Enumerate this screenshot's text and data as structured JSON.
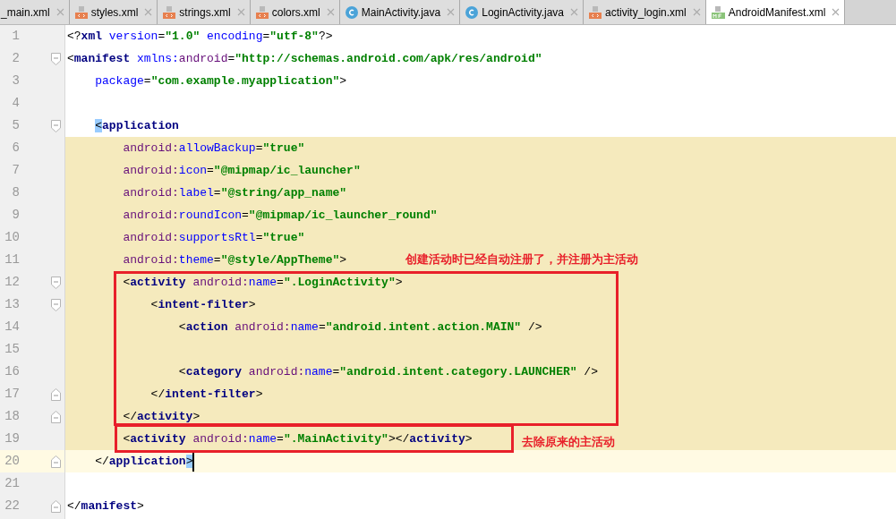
{
  "tabs": [
    {
      "label": "_main.xml",
      "kind": "cut",
      "selected": false
    },
    {
      "label": "styles.xml",
      "kind": "xml",
      "selected": false
    },
    {
      "label": "strings.xml",
      "kind": "xml",
      "selected": false
    },
    {
      "label": "colors.xml",
      "kind": "xml",
      "selected": false
    },
    {
      "label": "MainActivity.java",
      "kind": "java",
      "selected": false
    },
    {
      "label": "LoginActivity.java",
      "kind": "java",
      "selected": false
    },
    {
      "label": "activity_login.xml",
      "kind": "xml",
      "selected": false
    },
    {
      "label": "AndroidManifest.xml",
      "kind": "manifest",
      "selected": true
    }
  ],
  "editor": {
    "lines": [
      {
        "number": "1",
        "fold_open": false,
        "fold_close": false,
        "scope": false,
        "current": false,
        "tokens": [
          {
            "t": "<?",
            "kind": "punct"
          },
          {
            "t": "xml",
            "kind": "tag"
          },
          {
            "t": " version",
            "kind": "attribute"
          },
          {
            "t": "=",
            "kind": "punct"
          },
          {
            "t": "\"1.0\"",
            "kind": "value"
          },
          {
            "t": " encoding",
            "kind": "attribute"
          },
          {
            "t": "=",
            "kind": "punct"
          },
          {
            "t": "\"utf-8\"",
            "kind": "value"
          },
          {
            "t": "?>",
            "kind": "punct"
          }
        ]
      },
      {
        "number": "2",
        "fold_open": true,
        "fold_close": false,
        "scope": false,
        "current": false,
        "tokens": [
          {
            "t": "<",
            "kind": "punct"
          },
          {
            "t": "manifest",
            "kind": "tag"
          },
          {
            "t": " xmlns:",
            "kind": "attribute"
          },
          {
            "t": "android",
            "kind": "namespace"
          },
          {
            "t": "=",
            "kind": "punct"
          },
          {
            "t": "\"http://schemas.android.com/apk/res/android\"",
            "kind": "value"
          }
        ]
      },
      {
        "number": "3",
        "fold_open": false,
        "fold_close": false,
        "scope": false,
        "current": false,
        "tokens": [
          {
            "t": "    package",
            "kind": "attribute"
          },
          {
            "t": "=",
            "kind": "punct"
          },
          {
            "t": "\"com.example.myapplication\"",
            "kind": "value"
          },
          {
            "t": ">",
            "kind": "punct"
          }
        ]
      },
      {
        "number": "4",
        "fold_open": false,
        "fold_close": false,
        "scope": false,
        "current": false
      },
      {
        "number": "5",
        "fold_open": true,
        "fold_close": false,
        "scope": false,
        "current": false,
        "tokens": [
          {
            "t": "    <",
            "kind": "bracket-match"
          },
          {
            "t": "application",
            "kind": "tag"
          }
        ]
      },
      {
        "number": "6",
        "fold_open": false,
        "fold_close": false,
        "scope": true,
        "current": false,
        "tokens": [
          {
            "t": "        android:",
            "kind": "namespace"
          },
          {
            "t": "allowBackup",
            "kind": "attribute"
          },
          {
            "t": "=",
            "kind": "punct"
          },
          {
            "t": "\"true\"",
            "kind": "value"
          }
        ]
      },
      {
        "number": "7",
        "fold_open": false,
        "fold_close": false,
        "scope": true,
        "current": false,
        "tokens": [
          {
            "t": "        android:",
            "kind": "namespace"
          },
          {
            "t": "icon",
            "kind": "attribute"
          },
          {
            "t": "=",
            "kind": "punct"
          },
          {
            "t": "\"@mipmap/ic_launcher\"",
            "kind": "value"
          }
        ]
      },
      {
        "number": "8",
        "fold_open": false,
        "fold_close": false,
        "scope": true,
        "current": false,
        "tokens": [
          {
            "t": "        android:",
            "kind": "namespace"
          },
          {
            "t": "label",
            "kind": "attribute"
          },
          {
            "t": "=",
            "kind": "punct"
          },
          {
            "t": "\"@string/app_name\"",
            "kind": "value"
          }
        ]
      },
      {
        "number": "9",
        "fold_open": false,
        "fold_close": false,
        "scope": true,
        "current": false,
        "tokens": [
          {
            "t": "        android:",
            "kind": "namespace"
          },
          {
            "t": "roundIcon",
            "kind": "attribute"
          },
          {
            "t": "=",
            "kind": "punct"
          },
          {
            "t": "\"@mipmap/ic_launcher_round\"",
            "kind": "value"
          }
        ]
      },
      {
        "number": "10",
        "fold_open": false,
        "fold_close": false,
        "scope": true,
        "current": false,
        "tokens": [
          {
            "t": "        android:",
            "kind": "namespace"
          },
          {
            "t": "supportsRtl",
            "kind": "attribute"
          },
          {
            "t": "=",
            "kind": "punct"
          },
          {
            "t": "\"true\"",
            "kind": "value"
          }
        ]
      },
      {
        "number": "11",
        "fold_open": false,
        "fold_close": false,
        "scope": true,
        "current": false,
        "tokens": [
          {
            "t": "        android:",
            "kind": "namespace"
          },
          {
            "t": "theme",
            "kind": "attribute"
          },
          {
            "t": "=",
            "kind": "punct"
          },
          {
            "t": "\"@style/AppTheme\"",
            "kind": "value"
          },
          {
            "t": ">",
            "kind": "punct"
          }
        ]
      },
      {
        "number": "12",
        "fold_open": true,
        "fold_close": false,
        "scope": true,
        "current": false,
        "tokens": [
          {
            "t": "        <",
            "kind": "punct"
          },
          {
            "t": "activity",
            "kind": "tag"
          },
          {
            "t": " android:",
            "kind": "namespace"
          },
          {
            "t": "name",
            "kind": "attribute"
          },
          {
            "t": "=",
            "kind": "punct"
          },
          {
            "t": "\".LoginActivity\"",
            "kind": "value"
          },
          {
            "t": ">",
            "kind": "punct"
          }
        ]
      },
      {
        "number": "13",
        "fold_open": true,
        "fold_close": false,
        "scope": true,
        "current": false,
        "tokens": [
          {
            "t": "            <",
            "kind": "punct"
          },
          {
            "t": "intent-filter",
            "kind": "tag"
          },
          {
            "t": ">",
            "kind": "punct"
          }
        ]
      },
      {
        "number": "14",
        "fold_open": false,
        "fold_close": false,
        "scope": true,
        "current": false,
        "tokens": [
          {
            "t": "                <",
            "kind": "punct"
          },
          {
            "t": "action",
            "kind": "tag"
          },
          {
            "t": " android:",
            "kind": "namespace"
          },
          {
            "t": "name",
            "kind": "attribute"
          },
          {
            "t": "=",
            "kind": "punct"
          },
          {
            "t": "\"android.intent.action.MAIN\"",
            "kind": "value"
          },
          {
            "t": " />",
            "kind": "punct"
          }
        ]
      },
      {
        "number": "15",
        "fold_open": false,
        "fold_close": false,
        "scope": true,
        "current": false
      },
      {
        "number": "16",
        "fold_open": false,
        "fold_close": false,
        "scope": true,
        "current": false,
        "tokens": [
          {
            "t": "                <",
            "kind": "punct"
          },
          {
            "t": "category",
            "kind": "tag"
          },
          {
            "t": " android:",
            "kind": "namespace"
          },
          {
            "t": "name",
            "kind": "attribute"
          },
          {
            "t": "=",
            "kind": "punct"
          },
          {
            "t": "\"android.intent.category.LAUNCHER\"",
            "kind": "value"
          },
          {
            "t": " />",
            "kind": "punct"
          }
        ]
      },
      {
        "number": "17",
        "fold_open": false,
        "fold_close": true,
        "scope": true,
        "current": false,
        "tokens": [
          {
            "t": "            </",
            "kind": "punct"
          },
          {
            "t": "intent-filter",
            "kind": "tag"
          },
          {
            "t": ">",
            "kind": "punct"
          }
        ]
      },
      {
        "number": "18",
        "fold_open": false,
        "fold_close": true,
        "scope": true,
        "current": false,
        "tokens": [
          {
            "t": "        </",
            "kind": "punct"
          },
          {
            "t": "activity",
            "kind": "tag"
          },
          {
            "t": ">",
            "kind": "punct"
          }
        ]
      },
      {
        "number": "19",
        "fold_open": false,
        "fold_close": false,
        "scope": true,
        "current": false,
        "tokens": [
          {
            "t": "        <",
            "kind": "punct"
          },
          {
            "t": "activity",
            "kind": "tag"
          },
          {
            "t": " android:",
            "kind": "namespace"
          },
          {
            "t": "name",
            "kind": "attribute"
          },
          {
            "t": "=",
            "kind": "punct"
          },
          {
            "t": "\".MainActivity\"",
            "kind": "value"
          },
          {
            "t": "></",
            "kind": "punct"
          },
          {
            "t": "activity",
            "kind": "tag"
          },
          {
            "t": ">",
            "kind": "punct"
          }
        ]
      },
      {
        "number": "20",
        "fold_open": false,
        "fold_close": true,
        "scope": false,
        "current": true,
        "tokens": [
          {
            "t": "    </",
            "kind": "punct"
          },
          {
            "t": "application",
            "kind": "tag"
          },
          {
            "t": ">",
            "kind": "bracket-match"
          }
        ]
      },
      {
        "number": "21",
        "fold_open": false,
        "fold_close": false,
        "scope": false,
        "current": false
      },
      {
        "number": "22",
        "fold_open": false,
        "fold_close": true,
        "scope": false,
        "current": false,
        "tokens": [
          {
            "t": "</",
            "kind": "punct"
          },
          {
            "t": "manifest",
            "kind": "tag"
          },
          {
            "t": ">",
            "kind": "punct"
          }
        ]
      }
    ]
  },
  "annotations": [
    {
      "note": "创建活动时已经自动注册了，并注册为主活动"
    },
    {
      "note": "去除原来的主活动"
    }
  ]
}
